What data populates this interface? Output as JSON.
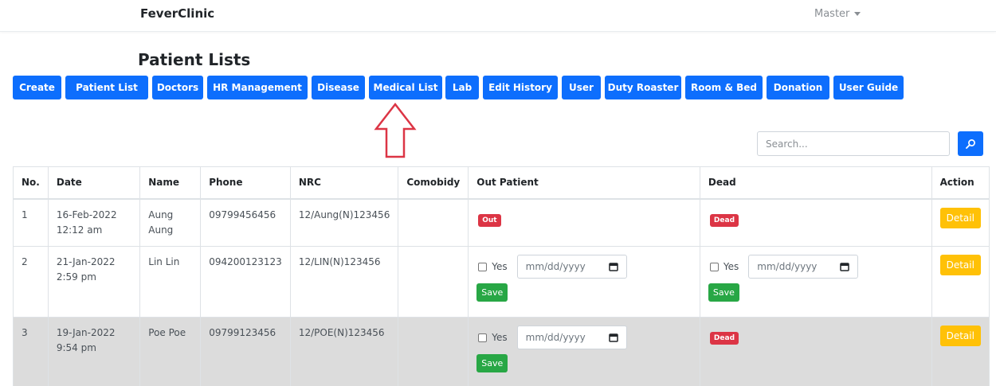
{
  "navbar": {
    "brand": "FeverClinic",
    "user": "Master"
  },
  "page_title": "Patient Lists",
  "nav_buttons": [
    "Create",
    "Patient List",
    "Doctors",
    "HR Management",
    "Disease",
    "Medical List",
    "Lab",
    "Edit History",
    "User",
    "Duty Roaster",
    "Room & Bed",
    "Donation",
    "User Guide"
  ],
  "search": {
    "placeholder": "Search..."
  },
  "table": {
    "headers": [
      "No.",
      "Date",
      "Name",
      "Phone",
      "NRC",
      "Comobidy",
      "Out Patient",
      "Dead",
      "Action"
    ],
    "rows": [
      {
        "no": "1",
        "date": "16-Feb-2022 12:12 am",
        "name": "Aung Aung",
        "phone": "09799456456",
        "nrc": "12/Aung(N)123456",
        "comobidy": "",
        "out_badge": "Out",
        "dead_badge": "Dead",
        "action": "Detail"
      },
      {
        "no": "2",
        "date": "21-Jan-2022 2:59 pm",
        "name": "Lin Lin",
        "phone": "094200123123",
        "nrc": "12/LIN(N)123456",
        "comobidy": "",
        "yes_label": "Yes",
        "date_placeholder": "mm/dd/yyyy",
        "save": "Save",
        "dead_yes_label": "Yes",
        "dead_date_placeholder": "mm/dd/yyyy",
        "dead_save": "Save",
        "action": "Detail"
      },
      {
        "no": "3",
        "date": "19-Jan-2022 9:54 pm",
        "name": "Poe Poe",
        "phone": "09799123456",
        "nrc": "12/POE(N)123456",
        "comobidy": "",
        "yes_label": "Yes",
        "date_placeholder": "mm/dd/yyyy",
        "save": "Save",
        "dead_badge": "Dead",
        "action": "Detail"
      }
    ]
  },
  "colors": {
    "primary": "#0d6efd",
    "danger": "#dc3545",
    "warning": "#ffc107",
    "success": "#28a745",
    "arrow": "#dc3545"
  }
}
